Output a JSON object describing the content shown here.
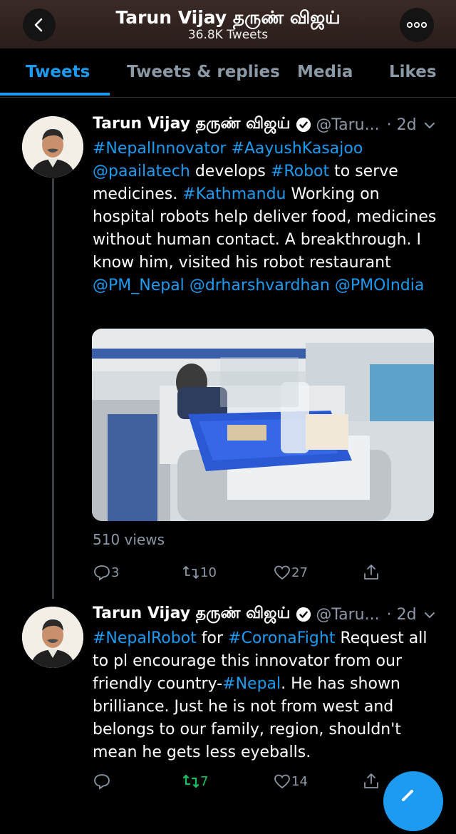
{
  "header": {
    "title": "Tarun Vijay தருண் விஜய்",
    "subtitle": "36.8K Tweets"
  },
  "tabs": [
    {
      "label": "Tweets",
      "active": true
    },
    {
      "label": "Tweets & replies",
      "active": false
    },
    {
      "label": "Media",
      "active": false
    },
    {
      "label": "Likes",
      "active": false
    }
  ],
  "colors": {
    "accent": "#1d9bf0",
    "retweet_active": "#17bf63"
  },
  "tweets": [
    {
      "name": "Tarun Vijay தருண் விஜய்",
      "handle": "@Taru...",
      "time": "· 2d",
      "text_parts": [
        {
          "t": "#NepalInnovator #AayushKasajoo",
          "link": true
        },
        {
          "t": "\n",
          "link": false
        },
        {
          "t": "@paailatech",
          "link": true
        },
        {
          "t": " develops ",
          "link": false
        },
        {
          "t": "#Robot",
          "link": true
        },
        {
          "t": " to serve medicines. ",
          "link": false
        },
        {
          "t": "#Kathmandu",
          "link": true
        },
        {
          "t": "  Working on hospital robots help deliver food, medicines without human contact. A breakthrough. I know him, visited his robot restaurant  ",
          "link": false
        },
        {
          "t": "@PM_Nepal",
          "link": true
        },
        {
          "t": " ",
          "link": false
        },
        {
          "t": "@drharshvardhan",
          "link": true
        },
        {
          "t": " ",
          "link": false
        },
        {
          "t": "@PMOIndia",
          "link": true
        }
      ],
      "views": "510 views",
      "reply_count": "3",
      "retweet_count": "10",
      "like_count": "27",
      "retweeted": false
    },
    {
      "name": "Tarun Vijay தருண் விஜய்",
      "handle": "@Taru...",
      "time": "· 2d",
      "text_parts": [
        {
          "t": "#NepalRobot",
          "link": true
        },
        {
          "t": " for ",
          "link": false
        },
        {
          "t": "#CoronaFight",
          "link": true
        },
        {
          "t": " Request all to pl encourage this innovator from our friendly country-",
          "link": false
        },
        {
          "t": "#Nepal",
          "link": true
        },
        {
          "t": ". He has shown brilliance. Just he is not from west and belongs to our family, region, shouldn't mean he gets less eyeballs.",
          "link": false
        }
      ],
      "reply_count": "",
      "retweet_count": "7",
      "like_count": "14",
      "retweeted": true
    }
  ]
}
